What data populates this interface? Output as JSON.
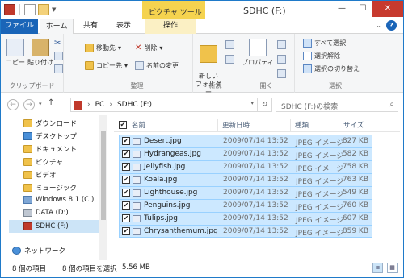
{
  "window": {
    "title": "SDHC (F:)",
    "context_tab": "ピクチャ ツール",
    "colors": {
      "file_tab": "#1a65b8",
      "context": "#f5d34f",
      "selection": "#cce8ff",
      "close": "#c73a2e"
    }
  },
  "ribbon_tabs": [
    "ファイル",
    "ホーム",
    "共有",
    "表示",
    "操作"
  ],
  "ribbon": {
    "clipboard": {
      "copy": "コピー",
      "paste": "貼り付け",
      "label": "クリップボード"
    },
    "organize": {
      "move_to": "移動先",
      "copy_to": "コピー先",
      "delete": "削除",
      "rename": "名前の変更",
      "label": "整理"
    },
    "new": {
      "new_folder": "新しい\nフォルダー",
      "label": "新規"
    },
    "open": {
      "properties": "プロパティ",
      "label": "開く"
    },
    "select": {
      "select_all": "すべて選択",
      "select_none": "選択解除",
      "invert": "選択の切り替え",
      "label": "選択"
    }
  },
  "address": {
    "path": [
      "PC",
      "SDHC (F:)"
    ],
    "search_placeholder": "SDHC (F:)の検索"
  },
  "nav_pane": {
    "items": [
      {
        "label": "ダウンロード",
        "icon": "download-folder-icon"
      },
      {
        "label": "デスクトップ",
        "icon": "desktop-folder-icon"
      },
      {
        "label": "ドキュメント",
        "icon": "documents-folder-icon"
      },
      {
        "label": "ピクチャ",
        "icon": "pictures-folder-icon"
      },
      {
        "label": "ビデオ",
        "icon": "videos-folder-icon"
      },
      {
        "label": "ミュージック",
        "icon": "music-folder-icon"
      },
      {
        "label": "Windows 8.1 (C:)",
        "icon": "windows-drive-icon"
      },
      {
        "label": "DATA (D:)",
        "icon": "drive-icon"
      },
      {
        "label": "SDHC (F:)",
        "icon": "sd-card-icon",
        "selected": true
      },
      {
        "label": "ネットワーク",
        "icon": "network-icon"
      }
    ]
  },
  "columns": {
    "name": "名前",
    "date": "更新日時",
    "type": "種類",
    "size": "サイズ"
  },
  "files": [
    {
      "name": "Desert.jpg",
      "date": "2009/07/14 13:52",
      "type": "JPEG イメージ",
      "size": "827 KB"
    },
    {
      "name": "Hydrangeas.jpg",
      "date": "2009/07/14 13:52",
      "type": "JPEG イメージ",
      "size": "582 KB"
    },
    {
      "name": "Jellyfish.jpg",
      "date": "2009/07/14 13:52",
      "type": "JPEG イメージ",
      "size": "758 KB"
    },
    {
      "name": "Koala.jpg",
      "date": "2009/07/14 13:52",
      "type": "JPEG イメージ",
      "size": "763 KB"
    },
    {
      "name": "Lighthouse.jpg",
      "date": "2009/07/14 13:52",
      "type": "JPEG イメージ",
      "size": "549 KB"
    },
    {
      "name": "Penguins.jpg",
      "date": "2009/07/14 13:52",
      "type": "JPEG イメージ",
      "size": "760 KB"
    },
    {
      "name": "Tulips.jpg",
      "date": "2009/07/14 13:52",
      "type": "JPEG イメージ",
      "size": "607 KB"
    },
    {
      "name": "Chrysanthemum.jpg",
      "date": "2009/07/14 13:52",
      "type": "JPEG イメージ",
      "size": "859 KB"
    }
  ],
  "status": {
    "item_count": "8 個の項目",
    "selected": "8 個の項目を選択",
    "size": "5.56 MB"
  }
}
